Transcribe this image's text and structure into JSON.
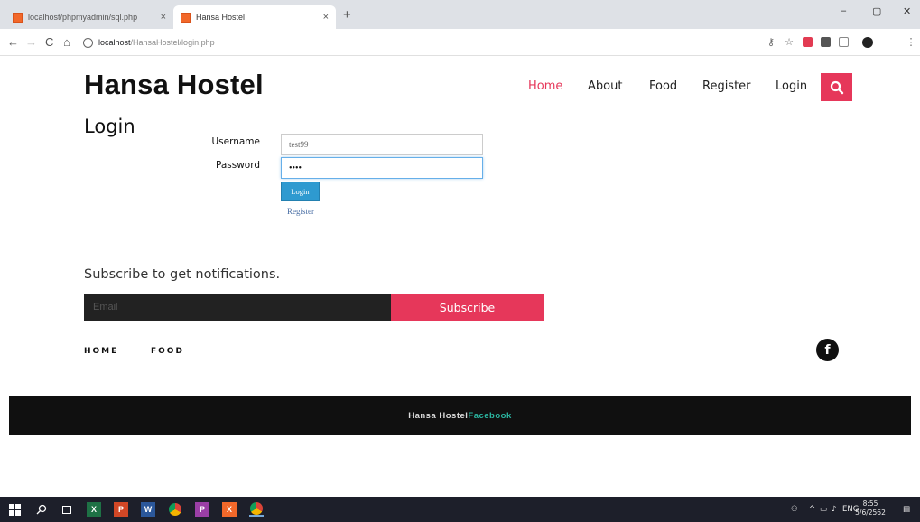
{
  "browser": {
    "tabs": [
      {
        "title": "localhost/phpmyadmin/sql.php"
      },
      {
        "title": "Hansa Hostel"
      }
    ],
    "tab_close": "×",
    "new_tab": "+",
    "window_controls": {
      "minimize": "–",
      "maximize": "▢",
      "close": "✕"
    },
    "nav": {
      "back": "←",
      "forward": "→",
      "reload": "C",
      "home": "⌂"
    },
    "info": "i",
    "url_host": "localhost",
    "url_path": "/HansaHostel/login.php"
  },
  "site": {
    "title": "Hansa Hostel",
    "nav": [
      {
        "label": "Home",
        "active": true
      },
      {
        "label": "About"
      },
      {
        "label": "Food"
      },
      {
        "label": "Register"
      },
      {
        "label": "Login"
      }
    ]
  },
  "login": {
    "heading": "Login",
    "username_label": "Username",
    "username_value": "test99",
    "password_label": "Password",
    "password_value": "••••",
    "login_button": "Login",
    "register_link": "Register"
  },
  "subscribe": {
    "heading": "Subscribe to get notifications.",
    "email_placeholder": "Email",
    "button": "Subscribe"
  },
  "footer": {
    "links": [
      "HOME",
      "FOOD"
    ],
    "facebook_icon": "f",
    "brand": "Hansa Hostel",
    "facebook_link": "Facebook"
  },
  "taskbar": {
    "tray_language": "ENG",
    "time": "8:55",
    "date": "5/6/2562"
  },
  "colors": {
    "accent": "#e6375a",
    "login_button": "#2e9ad0",
    "footer_link": "#2bb5a0"
  }
}
